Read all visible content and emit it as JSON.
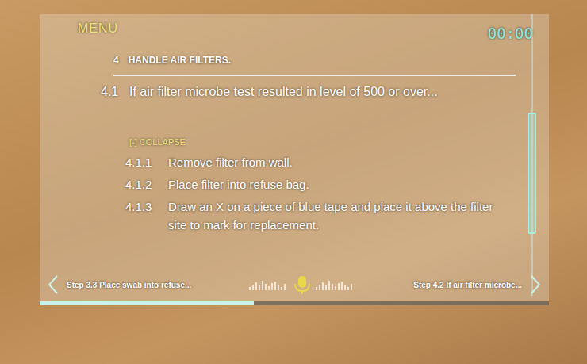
{
  "menu": {
    "label": "MENU"
  },
  "timer": "00:00",
  "section": {
    "number": "4",
    "title": "HANDLE AIR FILTERS."
  },
  "step": {
    "number": "4.1",
    "text": "If air filter microbe test resulted in level of 500 or over..."
  },
  "collapse": {
    "label": "[-] COLLAPSE",
    "expanded": true
  },
  "substeps": [
    {
      "number": "4.1.1",
      "text": "Remove filter from wall."
    },
    {
      "number": "4.1.2",
      "text": "Place filter into refuse bag."
    },
    {
      "number": "4.1.3",
      "text": "Draw an X on a piece of blue tape and place it above the filter site to mark for replacement."
    }
  ],
  "scrollbar": {
    "offset": 0.35,
    "level": 0.43
  },
  "previous_step": {
    "label": "Step 3.3 Place swab into refuse..."
  },
  "next_step": {
    "label": "Step 4.2 If air filter microbe..."
  },
  "progress": {
    "level": 0.42
  }
}
